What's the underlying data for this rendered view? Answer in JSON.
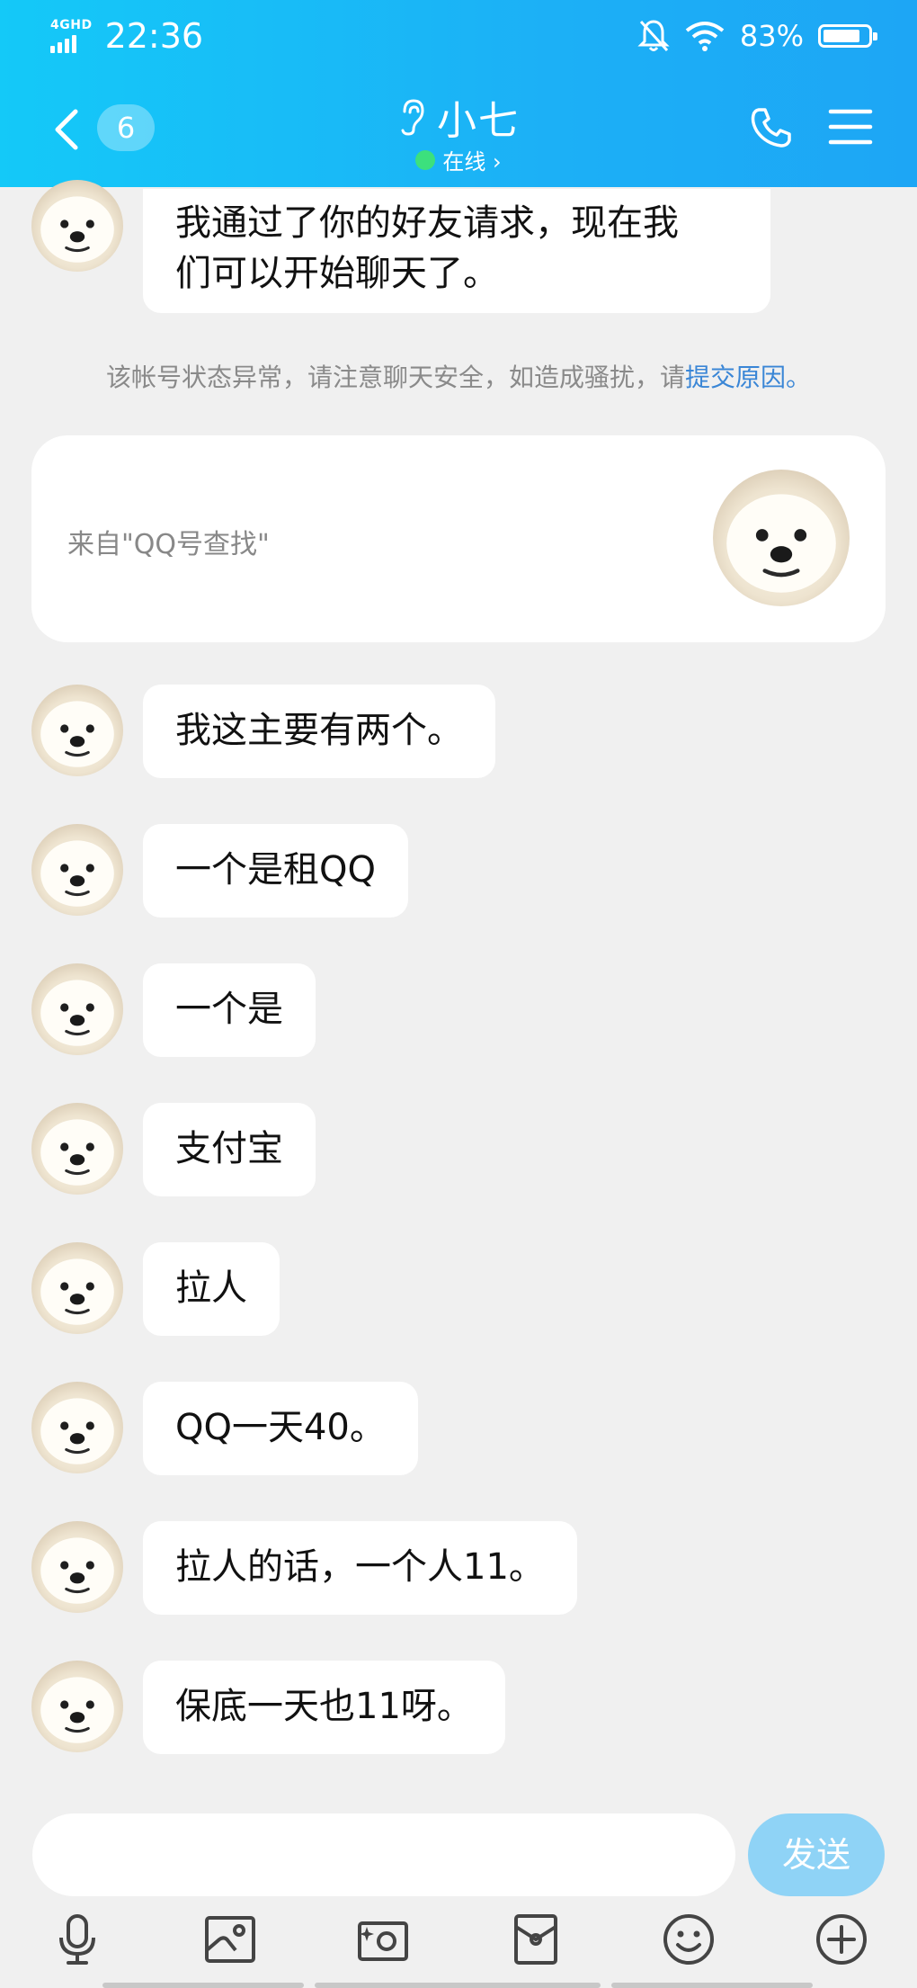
{
  "status_bar": {
    "network": "4GHD",
    "time": "22:36",
    "battery_percent": "83%",
    "battery_level": 0.83
  },
  "header": {
    "unread_count": "6",
    "contact_name": "小七",
    "online_status": "在线 ›"
  },
  "messages": [
    {
      "text_lines": [
        "我通过了你的好友请求，现在我",
        "们可以开始聊天了。"
      ]
    },
    {
      "text": "我这主要有两个。"
    },
    {
      "text": "一个是租QQ"
    },
    {
      "text": "一个是"
    },
    {
      "text": "支付宝"
    },
    {
      "text": "拉人"
    },
    {
      "text": "QQ一天40。"
    },
    {
      "text": "拉人的话，一个人11。"
    },
    {
      "text": "保底一天也11呀。"
    }
  ],
  "warning": {
    "text": "该帐号状态异常，请注意聊天安全，如造成骚扰，请",
    "link": "提交原因",
    "suffix": "。"
  },
  "source_card": {
    "text": "来自\"QQ号查找\""
  },
  "input": {
    "placeholder": "",
    "send_label": "发送"
  },
  "toolbar": [
    "microphone-icon",
    "photo-icon",
    "camera-icon",
    "red-packet-icon",
    "emoji-icon",
    "plus-icon"
  ],
  "colors": {
    "header_start": "#14c9f8",
    "header_end": "#1da6f5",
    "online_dot": "#3ce07d",
    "link": "#3a86d6",
    "send_button": "#8fd3f6",
    "background": "#f0f0f0"
  }
}
